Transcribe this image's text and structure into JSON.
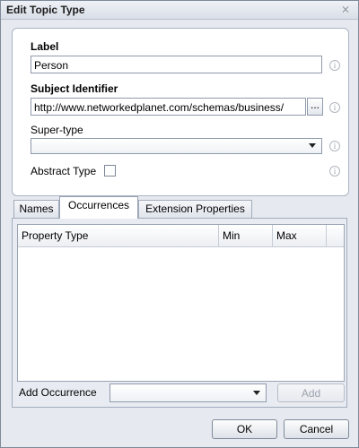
{
  "window": {
    "title": "Edit Topic Type",
    "close_glyph": "⨯"
  },
  "form": {
    "label_caption": "Label",
    "label_value": "Person",
    "subject_caption": "Subject Identifier",
    "subject_value": "http://www.networkedplanet.com/schemas/business/",
    "browse_label": "...",
    "supertype_caption": "Super-type",
    "supertype_value": "",
    "abstract_caption": "Abstract Type",
    "abstract_checked": false,
    "info_glyph": "i"
  },
  "tabs": [
    {
      "label": "Names",
      "active": false
    },
    {
      "label": "Occurrences",
      "active": true
    },
    {
      "label": "Extension Properties",
      "active": false
    }
  ],
  "occurrences": {
    "columns": [
      "Property Type",
      "Min",
      "Max"
    ],
    "rows": [],
    "add_caption": "Add Occurrence",
    "add_select_value": "",
    "add_button": "Add"
  },
  "buttons": {
    "ok": "OK",
    "cancel": "Cancel"
  },
  "icons": [
    "close-icon",
    "info-icon",
    "chevron-down-icon"
  ]
}
